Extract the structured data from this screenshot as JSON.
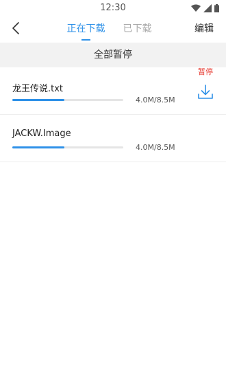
{
  "status_bar": {
    "time": "12:30",
    "icons": [
      "wifi-icon",
      "signal-icon",
      "battery-icon"
    ]
  },
  "nav": {
    "back_icon": "chevron-left-icon",
    "tabs": [
      {
        "label": "正在下载",
        "active": true
      },
      {
        "label": "已下载",
        "active": false
      }
    ],
    "edit_label": "编辑"
  },
  "pause_all_label": "全部暂停",
  "downloads": [
    {
      "name": "龙王传说.txt",
      "size_text": "4.0M/8.5M",
      "progress": 0.47,
      "action": "download-icon"
    },
    {
      "name": "JACKW.Image",
      "size_text": "4.0M/8.5M",
      "progress": 0.47,
      "status_label": "暂停"
    }
  ],
  "colors": {
    "accent": "#2e91e8",
    "paused": "#e8453c",
    "bar_bg": "#f2f2f2"
  }
}
